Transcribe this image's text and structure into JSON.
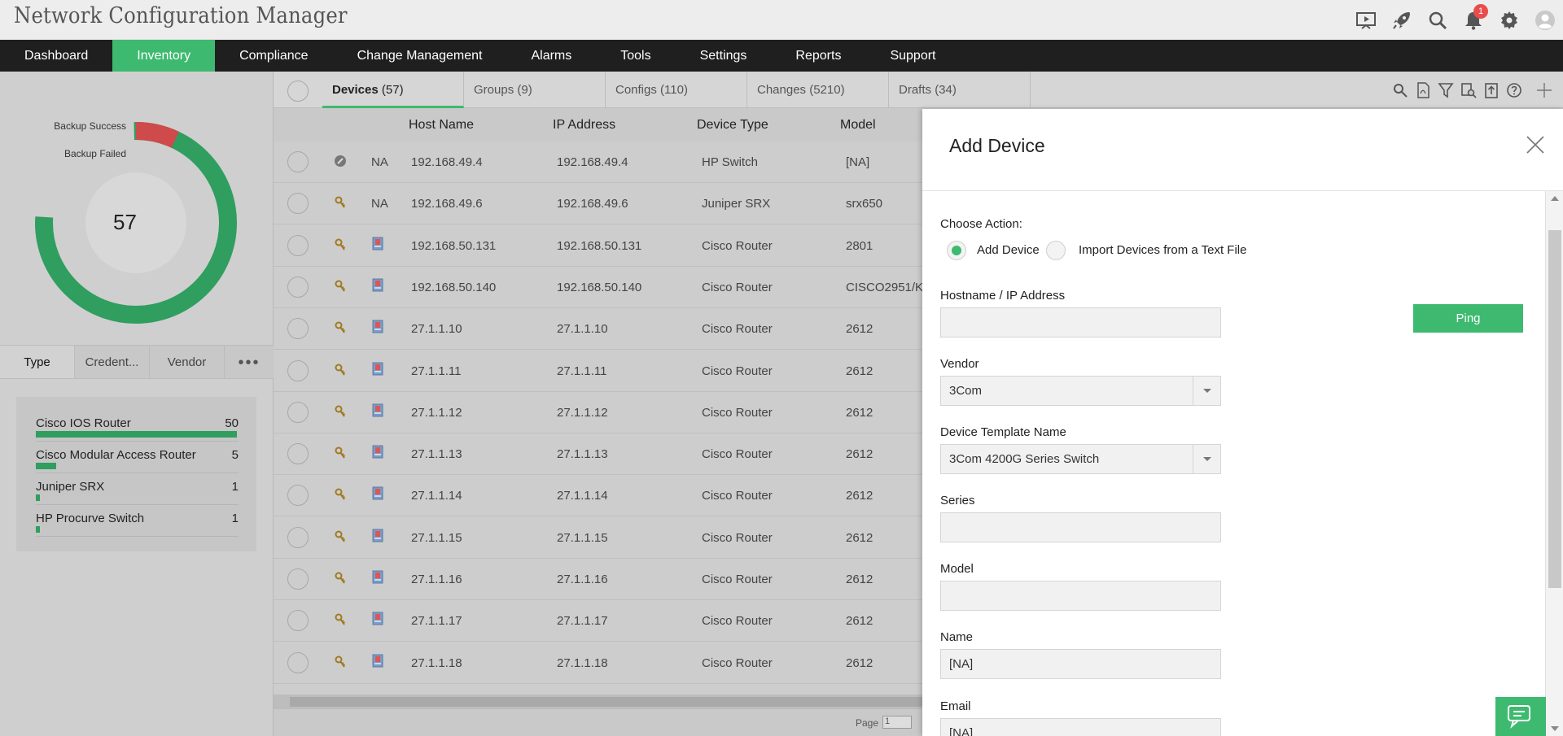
{
  "app": {
    "title": "Network Configuration Manager",
    "notification_count": "1"
  },
  "nav": {
    "items": [
      "Dashboard",
      "Inventory",
      "Compliance",
      "Change Management",
      "Alarms",
      "Tools",
      "Settings",
      "Reports",
      "Support"
    ],
    "active": "Inventory"
  },
  "backup_summary": {
    "legend_success": "Backup Success",
    "legend_failed": "Backup Failed",
    "total": "57",
    "success_count": 53,
    "failed_count": 4,
    "colors": {
      "success": "#2f9e5f",
      "failed": "#cf4a4a"
    }
  },
  "left_tabs": [
    "Type",
    "Credent...",
    "Vendor",
    "•••"
  ],
  "type_list": [
    {
      "name": "Cisco IOS Router",
      "count": "50",
      "fraction": 1.0
    },
    {
      "name": "Cisco Modular Access Router",
      "count": "5",
      "fraction": 0.1
    },
    {
      "name": "Juniper SRX",
      "count": "1",
      "fraction": 0.02
    },
    {
      "name": "HP Procurve Switch",
      "count": "1",
      "fraction": 0.02
    }
  ],
  "tabs": [
    {
      "label": "Devices",
      "count": "(57)"
    },
    {
      "label": "Groups",
      "count": "(9)"
    },
    {
      "label": "Configs",
      "count": "(110)"
    },
    {
      "label": "Changes",
      "count": "(5210)"
    },
    {
      "label": "Drafts",
      "count": "(34)"
    }
  ],
  "tool_icons": [
    "search-icon",
    "pdf-icon",
    "filter-icon",
    "find-device-icon",
    "export-icon",
    "help-icon"
  ],
  "table": {
    "headers": [
      "Host Name",
      "IP Address",
      "Device Type",
      "Model"
    ],
    "rows": [
      {
        "status": "NA",
        "host": "192.168.49.4",
        "ip": "192.168.49.4",
        "type": "HP Switch",
        "model": "[NA]",
        "icon": "gear"
      },
      {
        "status": "NA",
        "host": "192.168.49.6",
        "ip": "192.168.49.6",
        "type": "Juniper SRX",
        "model": "srx650",
        "icon": "key"
      },
      {
        "status": "",
        "host": "192.168.50.131",
        "ip": "192.168.50.131",
        "type": "Cisco Router",
        "model": "2801",
        "icon": "key"
      },
      {
        "status": "",
        "host": "192.168.50.140",
        "ip": "192.168.50.140",
        "type": "Cisco Router",
        "model": "CISCO2951/K",
        "icon": "key"
      },
      {
        "status": "",
        "host": "27.1.1.10",
        "ip": "27.1.1.10",
        "type": "Cisco Router",
        "model": "2612",
        "icon": "key"
      },
      {
        "status": "",
        "host": "27.1.1.11",
        "ip": "27.1.1.11",
        "type": "Cisco Router",
        "model": "2612",
        "icon": "key"
      },
      {
        "status": "",
        "host": "27.1.1.12",
        "ip": "27.1.1.12",
        "type": "Cisco Router",
        "model": "2612",
        "icon": "key"
      },
      {
        "status": "",
        "host": "27.1.1.13",
        "ip": "27.1.1.13",
        "type": "Cisco Router",
        "model": "2612",
        "icon": "key"
      },
      {
        "status": "",
        "host": "27.1.1.14",
        "ip": "27.1.1.14",
        "type": "Cisco Router",
        "model": "2612",
        "icon": "key"
      },
      {
        "status": "",
        "host": "27.1.1.15",
        "ip": "27.1.1.15",
        "type": "Cisco Router",
        "model": "2612",
        "icon": "key"
      },
      {
        "status": "",
        "host": "27.1.1.16",
        "ip": "27.1.1.16",
        "type": "Cisco Router",
        "model": "2612",
        "icon": "key"
      },
      {
        "status": "",
        "host": "27.1.1.17",
        "ip": "27.1.1.17",
        "type": "Cisco Router",
        "model": "2612",
        "icon": "key"
      },
      {
        "status": "",
        "host": "27.1.1.18",
        "ip": "27.1.1.18",
        "type": "Cisco Router",
        "model": "2612",
        "icon": "key"
      }
    ]
  },
  "pager": {
    "label": "Page",
    "value": "1"
  },
  "add_device": {
    "title": "Add Device",
    "choose_action_label": "Choose Action:",
    "radio_add": "Add Device",
    "radio_import": "Import Devices from a Text File",
    "hostname_label": "Hostname / IP Address",
    "hostname_value": "",
    "ping_label": "Ping",
    "vendor_label": "Vendor",
    "vendor_value": "3Com",
    "template_label": "Device Template Name",
    "template_value": "3Com 4200G Series Switch",
    "series_label": "Series",
    "series_value": "",
    "model_label": "Model",
    "model_value": "",
    "name_label": "Name",
    "name_value": "[NA]",
    "email_label": "Email",
    "email_value": "[NA]"
  },
  "accent_color": "#3dba6f"
}
